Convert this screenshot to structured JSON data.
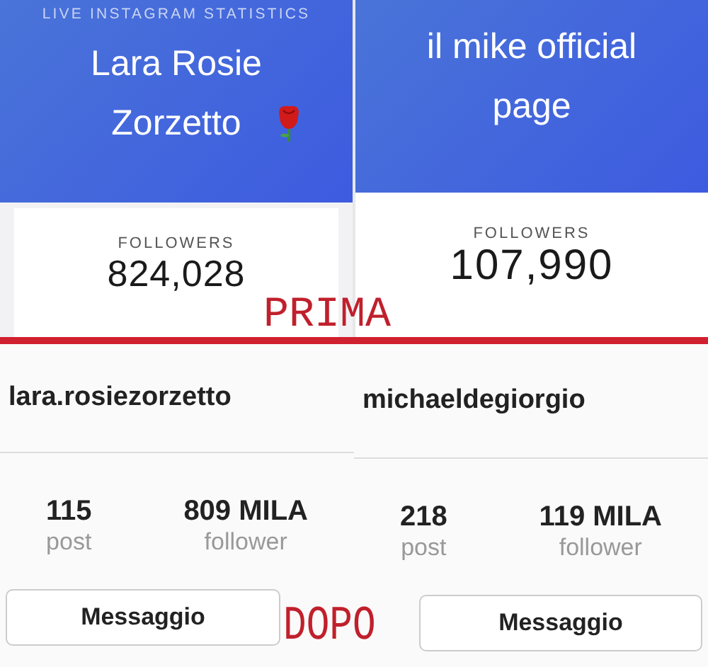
{
  "before": {
    "label": "PRIMA",
    "panels": [
      {
        "header": "LIVE INSTAGRAM STATISTICS",
        "name": "Lara Rosie Zorzetto",
        "emoji": true,
        "followers_label": "FOLLOWERS",
        "followers": "824,028"
      },
      {
        "name": "il mike official page",
        "emoji": false,
        "followers_label": "FOLLOWERS",
        "followers": "107,990"
      }
    ]
  },
  "after": {
    "label": "DOPO",
    "profiles": [
      {
        "username": "lara.rosiezorzetto",
        "posts": "115",
        "posts_label": "post",
        "followers": "809 MILA",
        "followers_label": "follower",
        "button": "Messaggio"
      },
      {
        "username": "michaeldegiorgio",
        "posts": "218",
        "posts_label": "post",
        "followers": "119 MILA",
        "followers_label": "follower",
        "button": "Messaggio"
      }
    ]
  }
}
